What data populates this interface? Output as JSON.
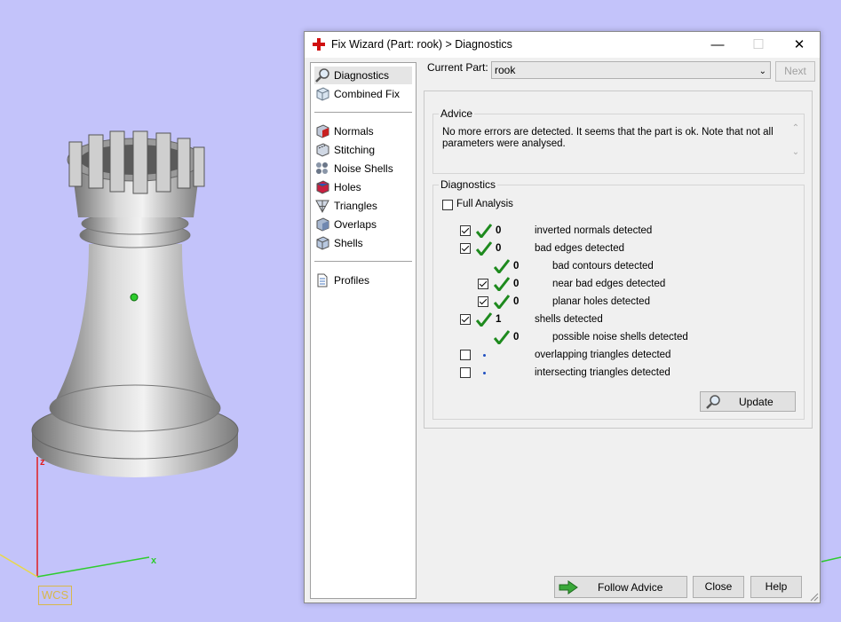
{
  "viewport": {
    "axis_x": "x",
    "axis_z": "z",
    "wcs_label": "WCS"
  },
  "window": {
    "title": "Fix Wizard (Part: rook) > Diagnostics",
    "minimize": "—",
    "maximize": "☐",
    "close": "✕"
  },
  "sidebar": {
    "items": [
      {
        "label": "Diagnostics",
        "icon": "magnifier-icon"
      },
      {
        "label": "Combined Fix",
        "icon": "cube-icon"
      },
      {
        "label": "Normals",
        "icon": "normals-cube-icon"
      },
      {
        "label": "Stitching",
        "icon": "stitching-icon"
      },
      {
        "label": "Noise Shells",
        "icon": "noise-shells-icon"
      },
      {
        "label": "Holes",
        "icon": "holes-icon"
      },
      {
        "label": "Triangles",
        "icon": "triangles-icon"
      },
      {
        "label": "Overlaps",
        "icon": "overlaps-icon"
      },
      {
        "label": "Shells",
        "icon": "shells-icon"
      },
      {
        "label": "Profiles",
        "icon": "document-icon"
      }
    ]
  },
  "current_part": {
    "label": "Current Part:",
    "value": "rook",
    "next_label": "Next"
  },
  "advice": {
    "title": "Advice",
    "text": "No more errors are detected. It seems that the part is ok. Note that not all parameters were analysed."
  },
  "diagnostics": {
    "title": "Diagnostics",
    "full_analysis_label": "Full Analysis",
    "full_analysis_checked": false,
    "rows": [
      {
        "checked": true,
        "status": "ok",
        "count": "0",
        "desc": "inverted normals detected"
      },
      {
        "checked": true,
        "status": "ok",
        "count": "0",
        "desc": "bad edges detected"
      },
      {
        "checked": null,
        "status": "ok",
        "count": "0",
        "desc": "bad contours detected"
      },
      {
        "checked": true,
        "status": "ok",
        "count": "0",
        "desc": "near bad edges detected"
      },
      {
        "checked": true,
        "status": "ok",
        "count": "0",
        "desc": "planar holes detected"
      },
      {
        "checked": true,
        "status": "ok",
        "count": "1",
        "desc": "shells detected"
      },
      {
        "checked": null,
        "status": "ok",
        "count": "0",
        "desc": "possible noise shells detected"
      },
      {
        "checked": false,
        "status": "pending",
        "count": "",
        "desc": "overlapping triangles detected"
      },
      {
        "checked": false,
        "status": "pending",
        "count": "",
        "desc": "intersecting triangles detected"
      }
    ],
    "update_label": "Update"
  },
  "footer": {
    "follow_advice_label": "Follow Advice",
    "close_label": "Close",
    "help_label": "Help"
  },
  "colors": {
    "background": "#c3c3fa",
    "check_green": "#1e8a1e",
    "axis_x": "#2ecc2e",
    "axis_z": "#e02020",
    "wcs": "#d8b84a"
  }
}
